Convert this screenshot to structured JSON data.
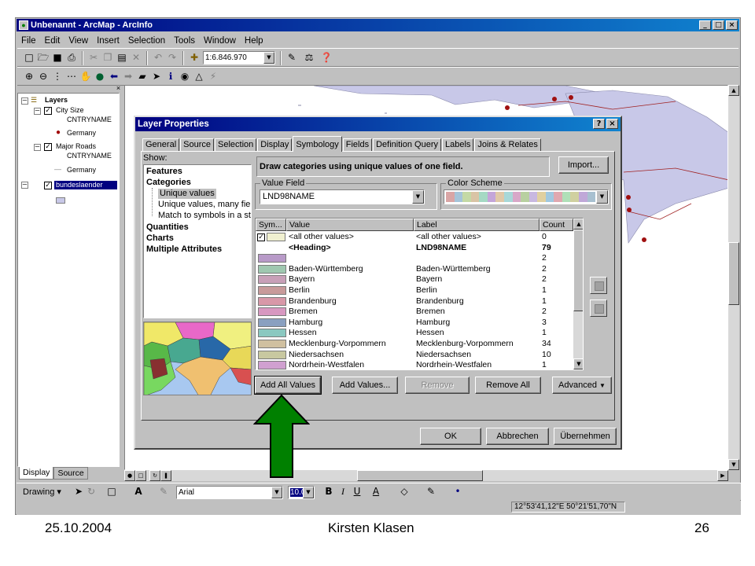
{
  "window": {
    "title": "Unbenannt - ArcMap - ArcInfo",
    "controls": [
      "_",
      "□",
      "×"
    ]
  },
  "menu": [
    "File",
    "Edit",
    "View",
    "Insert",
    "Selection",
    "Tools",
    "Window",
    "Help"
  ],
  "toolbar": {
    "scale": "1:6.846.970"
  },
  "toc": {
    "root": "Layers",
    "layers": [
      {
        "name": "City Size",
        "field": "CNTRYNAME",
        "class": "Germany"
      },
      {
        "name": "Major Roads",
        "field": "CNTRYNAME",
        "class": "Germany"
      },
      {
        "name": "bundeslaender"
      }
    ],
    "tabs": [
      "Display",
      "Source"
    ]
  },
  "drawing": {
    "label": "Drawing",
    "font": "Arial",
    "size": "10.0"
  },
  "status": {
    "coords": "12°53'41,12\"E 50°21'51,70\"N"
  },
  "dialog": {
    "title": "Layer Properties",
    "help_btn": "?",
    "close_btn": "×",
    "tabs": [
      "General",
      "Source",
      "Selection",
      "Display",
      "Symbology",
      "Fields",
      "Definition Query",
      "Labels",
      "Joins & Relates"
    ],
    "active_tab": "Symbology",
    "show_label": "Show:",
    "show_items": [
      {
        "text": "Features",
        "bold": true,
        "indent": 0
      },
      {
        "text": "Categories",
        "bold": true,
        "indent": 0
      },
      {
        "text": "Unique values",
        "bold": false,
        "indent": 1,
        "selected": true
      },
      {
        "text": "Unique values, many fields",
        "bold": false,
        "indent": 1
      },
      {
        "text": "Match to symbols in a style",
        "bold": false,
        "indent": 1
      },
      {
        "text": "Quantities",
        "bold": true,
        "indent": 0
      },
      {
        "text": "Charts",
        "bold": true,
        "indent": 0
      },
      {
        "text": "Multiple Attributes",
        "bold": true,
        "indent": 0
      }
    ],
    "description": "Draw categories using unique values of one field.",
    "import_btn": "Import...",
    "value_field": {
      "title": "Value Field",
      "value": "LND98NAME"
    },
    "color_scheme": {
      "title": "Color Scheme",
      "colors": [
        "#d9a5a5",
        "#a5c4d9",
        "#c4d9a5",
        "#d9c4a5",
        "#a5d9c4",
        "#c4a5d9",
        "#e0c8a8",
        "#a8d8d8",
        "#d8a8c8",
        "#b8d0a0",
        "#c8b8e0",
        "#e0d0a0",
        "#a0c8e0",
        "#e0a8b0",
        "#b0e0b8",
        "#d0d0a0",
        "#c0a8d8",
        "#a8c0d0"
      ]
    },
    "grid": {
      "headers": [
        "Sym...",
        "Value",
        "Label",
        "Count"
      ],
      "rows": [
        {
          "color": "#f0f0d0",
          "value": "<all other values>",
          "label": "<all other values>",
          "count": "0",
          "checkbox": true
        },
        {
          "color": "",
          "value": "<Heading>",
          "label": "LND98NAME",
          "count": "79",
          "bold": true
        },
        {
          "color": "#b89ac8",
          "value": "",
          "label": "",
          "count": "2"
        },
        {
          "color": "#9fc8b0",
          "value": "Baden-Württemberg",
          "label": "Baden-Württemberg",
          "count": "2"
        },
        {
          "color": "#c8a0b8",
          "value": "Bayern",
          "label": "Bayern",
          "count": "2"
        },
        {
          "color": "#c89a9a",
          "value": "Berlin",
          "label": "Berlin",
          "count": "1"
        },
        {
          "color": "#d898a8",
          "value": "Brandenburg",
          "label": "Brandenburg",
          "count": "1"
        },
        {
          "color": "#d898c0",
          "value": "Bremen",
          "label": "Bremen",
          "count": "2"
        },
        {
          "color": "#8aa0c0",
          "value": "Hamburg",
          "label": "Hamburg",
          "count": "3"
        },
        {
          "color": "#8ac8c0",
          "value": "Hessen",
          "label": "Hessen",
          "count": "1"
        },
        {
          "color": "#d0c0a0",
          "value": "Mecklenburg-Vorpommern",
          "label": "Mecklenburg-Vorpommern",
          "count": "34"
        },
        {
          "color": "#c8c8a0",
          "value": "Niedersachsen",
          "label": "Niedersachsen",
          "count": "10"
        },
        {
          "color": "#d0a0d0",
          "value": "Nordrhein-Westfalen",
          "label": "Nordrhein-Westfalen",
          "count": "1"
        }
      ]
    },
    "buttons": {
      "add_all": "Add All Values",
      "add": "Add Values...",
      "remove": "Remove",
      "remove_all": "Remove All",
      "advanced": "Advanced",
      "ok": "OK",
      "cancel": "Abbrechen",
      "apply": "Übernehmen"
    }
  },
  "footer": {
    "date": "25.10.2004",
    "author": "Kirsten Klasen",
    "page": "26"
  },
  "colors": {
    "titlebar": "#000080",
    "arrow": "#008000",
    "map_land": "#c8c8e8"
  }
}
